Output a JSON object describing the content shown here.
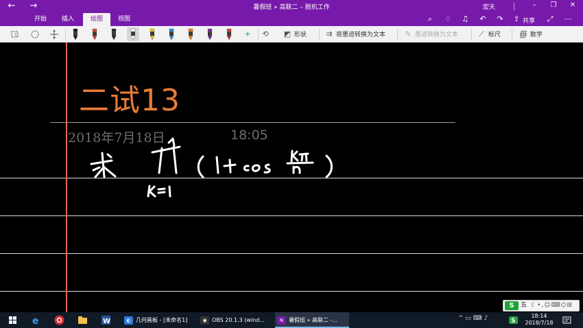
{
  "window": {
    "title": "暑假班 » 高联二 – 脱机工作",
    "user": "宏天",
    "back_glyph": "←",
    "forward_glyph": "→",
    "minimize_glyph": "–",
    "restore_glyph": "❐",
    "close_glyph": "✕"
  },
  "tabs": [
    {
      "label": "开始"
    },
    {
      "label": "插入"
    },
    {
      "label": "绘图",
      "active": true
    },
    {
      "label": "视图"
    }
  ],
  "tab_icons": {
    "search": "⌕",
    "lightbulb": "♢",
    "bell": "♫",
    "undo": "↶",
    "redo": "↷",
    "share": "共享",
    "share_glyph": "⇪",
    "expand": "⤢",
    "more": "⋯"
  },
  "ribbon": {
    "shapes_label": "形状",
    "ink_to_shape_label": "将墨迹转换为文本",
    "ink_to_text_label": "墨迹转换为文本",
    "ruler_label": "标尺",
    "math_label": "数学",
    "pens": [
      {
        "color": "#111111",
        "tip": "#111111"
      },
      {
        "color": "#e53935",
        "tip": "#e53935"
      },
      {
        "color": "#222222",
        "tip": "#222222"
      },
      {
        "color": "#ffffff",
        "tip": "#ffffff",
        "selected": true
      },
      {
        "color": "#f6c700",
        "tip": "#f6c700"
      },
      {
        "color": "#1e88e5",
        "tip": "#1e88e5"
      },
      {
        "color": "#f57c00",
        "tip": "#f57c00"
      },
      {
        "color": "#7b1fa2",
        "tip": "#7b1fa2"
      },
      {
        "color": "#e53935",
        "tip": "#c62828"
      }
    ]
  },
  "page": {
    "title": "二试13",
    "date": "2018年7月18日",
    "time": "18:05"
  },
  "ime": {
    "logo": "S",
    "mode": "五",
    "tools": "☾•,☺⌨⌬⊞"
  },
  "taskbar": {
    "apps": [
      {
        "label": "几何画板 - [未命名1]",
        "badge": "◐",
        "badge_color": "#2d7be0"
      },
      {
        "label": "OBS 20.1.3 (wind...",
        "badge": "◉",
        "badge_color": "#333333"
      },
      {
        "label": "暑假班 » 高联二 -...",
        "badge": "N",
        "badge_color": "#7719aa",
        "active": true
      }
    ],
    "clock_time": "18:14",
    "clock_date": "2018/7/18",
    "tray_icons": "^ ▭ ⌨ ♪"
  },
  "colors": {
    "accent": "#7719aa",
    "title_text": "#e77c36",
    "margin_line": "#e8674a",
    "ink": "#ffffff"
  }
}
